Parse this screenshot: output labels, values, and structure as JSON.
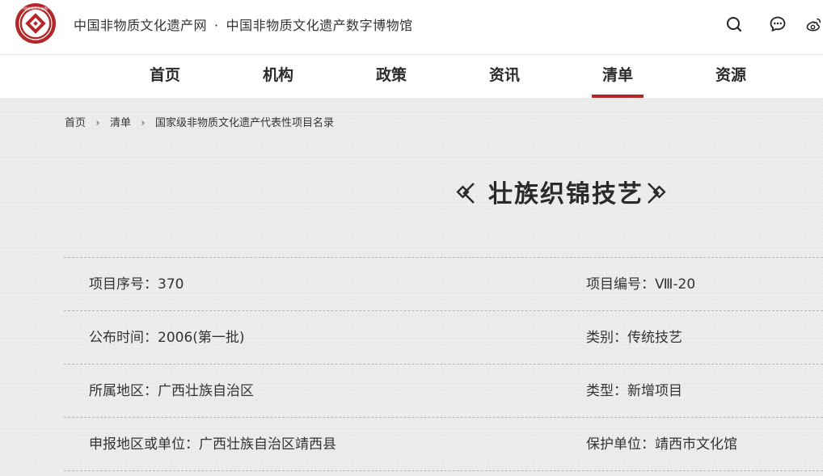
{
  "header": {
    "site_name_1": "中国非物质文化遗产网",
    "separator": "·",
    "site_name_2": "中国非物质文化遗产数字博物馆",
    "icons": [
      "logo-seal",
      "search-icon",
      "message-icon",
      "weibo-icon"
    ],
    "logo_text": "中国非物质文化遗产"
  },
  "nav": {
    "items": [
      {
        "label": "首页"
      },
      {
        "label": "机构"
      },
      {
        "label": "政策"
      },
      {
        "label": "资讯"
      },
      {
        "label": "清单"
      },
      {
        "label": "资源"
      }
    ],
    "active": "清单",
    "accent_color": "#b3262a"
  },
  "breadcrumb": {
    "items": [
      "首页",
      "清单",
      "国家级非物质文化遗产代表性项目名录"
    ]
  },
  "project": {
    "title": "壮族织锦技艺",
    "rows": [
      {
        "left": "项目序号：370",
        "right": "项目编号：Ⅷ-20"
      },
      {
        "left": "公布时间：2006(第一批)",
        "right": "类别：传统技艺"
      },
      {
        "left": "所属地区：广西壮族自治区",
        "right": "类型：新增项目"
      },
      {
        "left": "申报地区或单位：广西壮族自治区靖西县",
        "right": "保护单位：靖西市文化馆"
      }
    ]
  }
}
